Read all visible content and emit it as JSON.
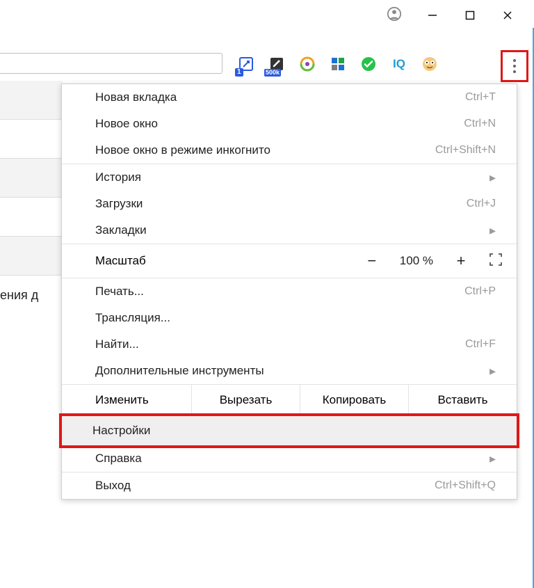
{
  "titlebar": {
    "user_icon": "user-circle-icon"
  },
  "extensions": {
    "e1_badge": "1",
    "e2_badge": "500k",
    "iq_text": "IQ"
  },
  "left_strip": {
    "text": "ения д"
  },
  "menu": {
    "new_tab": "Новая вкладка",
    "new_tab_sc": "Ctrl+T",
    "new_window": "Новое окно",
    "new_window_sc": "Ctrl+N",
    "incognito": "Новое окно в режиме инкогнито",
    "incognito_sc": "Ctrl+Shift+N",
    "history": "История",
    "downloads": "Загрузки",
    "downloads_sc": "Ctrl+J",
    "bookmarks": "Закладки",
    "zoom_label": "Масштаб",
    "zoom_minus": "−",
    "zoom_pct": "100 %",
    "zoom_plus": "+",
    "print": "Печать...",
    "print_sc": "Ctrl+P",
    "cast": "Трансляция...",
    "find": "Найти...",
    "find_sc": "Ctrl+F",
    "more_tools": "Дополнительные инструменты",
    "edit_label": "Изменить",
    "cut": "Вырезать",
    "copy": "Копировать",
    "paste": "Вставить",
    "settings": "Настройки",
    "help": "Справка",
    "exit": "Выход",
    "exit_sc": "Ctrl+Shift+Q",
    "submenu_arrow": "▸"
  }
}
